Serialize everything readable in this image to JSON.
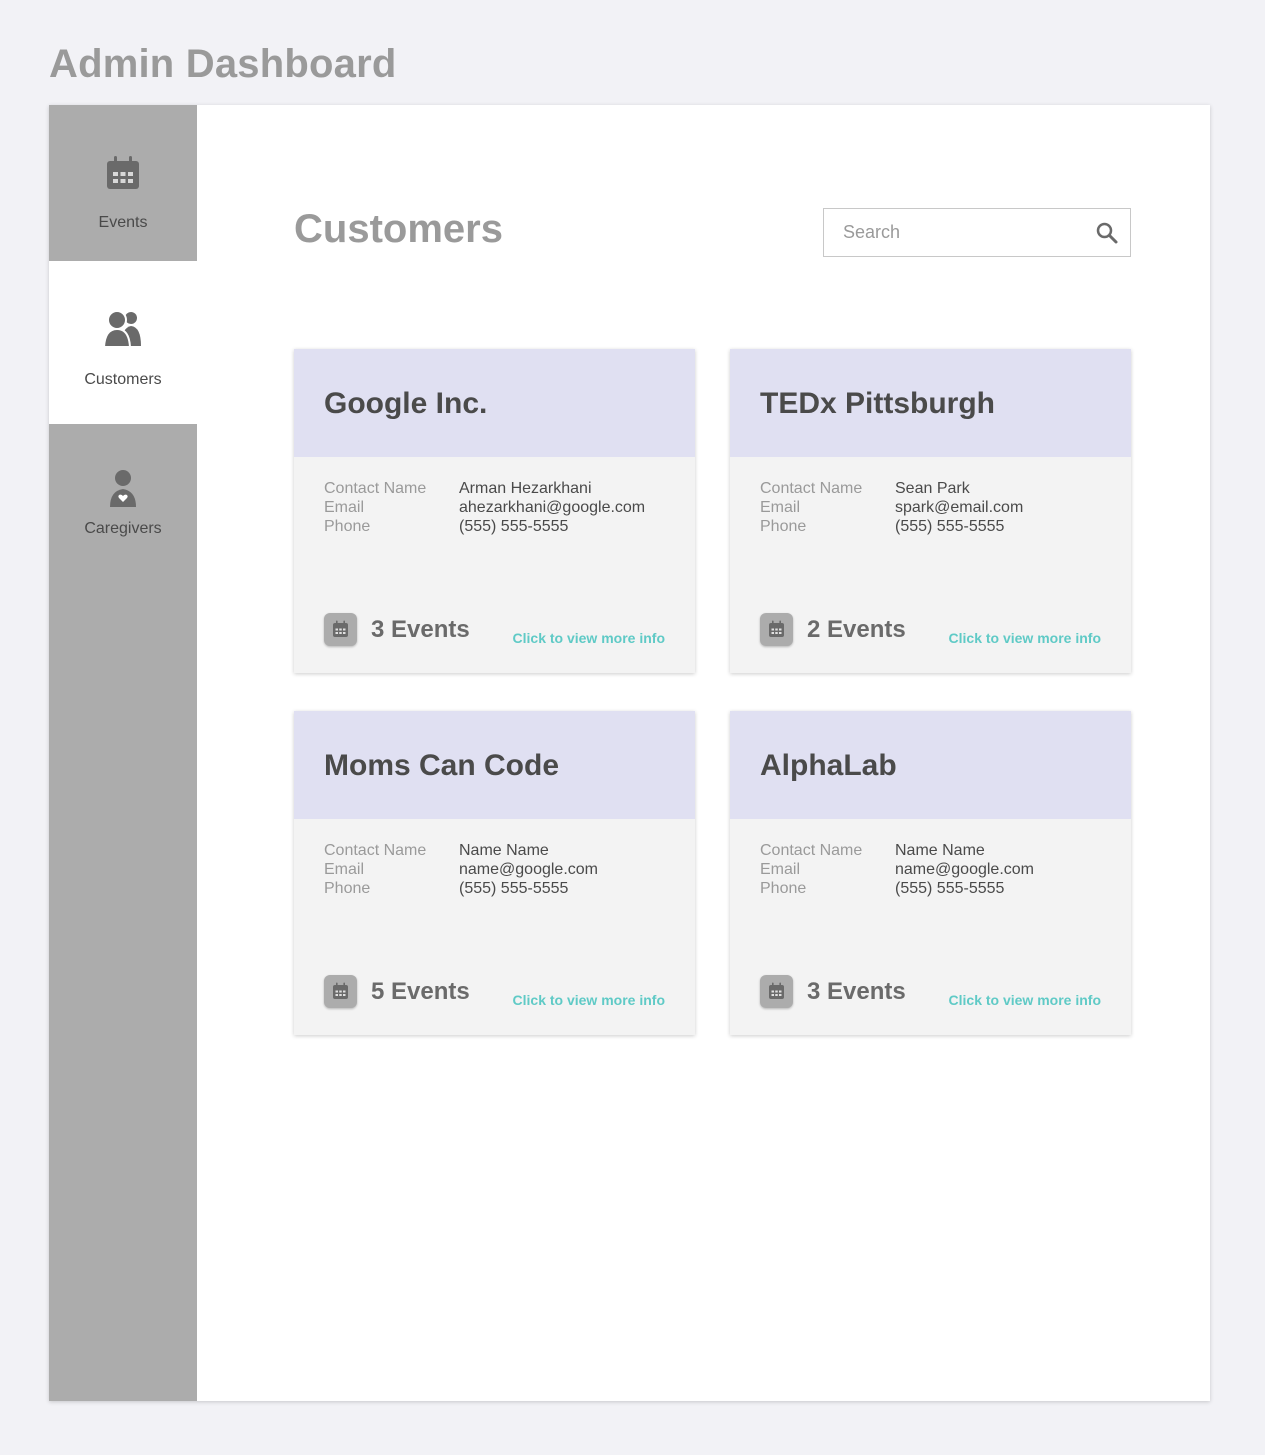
{
  "app": {
    "title": "Admin Dashboard"
  },
  "sidebar": {
    "items": [
      {
        "label": "Events",
        "icon": "calendar-icon",
        "active": false
      },
      {
        "label": "Customers",
        "icon": "users-icon",
        "active": true
      },
      {
        "label": "Caregivers",
        "icon": "caregiver-icon",
        "active": false
      }
    ]
  },
  "main": {
    "title": "Customers",
    "search": {
      "placeholder": "Search",
      "value": ""
    },
    "labels": {
      "contact_name": "Contact Name",
      "email": "Email",
      "phone": "Phone"
    },
    "cards": [
      {
        "name": "Google Inc.",
        "contact_name": "Arman Hezarkhani",
        "email": "ahezarkhani@google.com",
        "phone": "(555) 555-5555",
        "events": "3 Events",
        "link": "Click to view more info"
      },
      {
        "name": "TEDx Pittsburgh",
        "contact_name": "Sean Park",
        "email": "spark@email.com",
        "phone": "(555) 555-5555",
        "events": "2 Events",
        "link": "Click to view more info"
      },
      {
        "name": "Moms Can Code",
        "contact_name": "Name Name",
        "email": "name@google.com",
        "phone": "(555) 555-5555",
        "events": "5 Events",
        "link": "Click to view more info"
      },
      {
        "name": "AlphaLab",
        "contact_name": "Name Name",
        "email": "name@google.com",
        "phone": "(555) 555-5555",
        "events": "3 Events",
        "link": "Click to view more info"
      }
    ]
  },
  "colors": {
    "background": "#f2f2f6",
    "sidebar": "#acacac",
    "card_header": "#e0e0f2",
    "card_body": "#f3f3f3",
    "link": "#5fcac6",
    "title_gray": "#9a9a9a",
    "text_dark": "#4a4a4a"
  }
}
